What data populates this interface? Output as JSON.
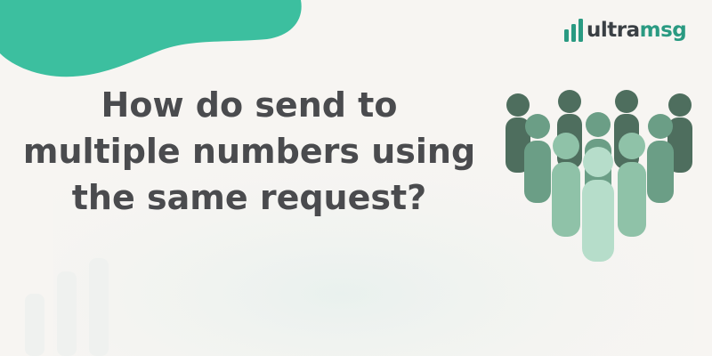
{
  "brand": {
    "logo_text_a": "ultra",
    "logo_text_b": "msg",
    "logo_icon": "signal-bars-icon",
    "accent": "#2a9a82",
    "dark": "#3a3f44"
  },
  "headline": {
    "lines": [
      "How do send to",
      "multiple numbers using",
      "the same request?"
    ],
    "color": "#4a4b4e"
  },
  "illustration": {
    "icon": "crowd-of-people-icon",
    "colors": [
      "#4e6e5e",
      "#6b9e86",
      "#8fc2a8",
      "#b6ddca"
    ]
  },
  "decor": {
    "blob_color": "#3cbf9f",
    "background": "#f7f5f2"
  }
}
